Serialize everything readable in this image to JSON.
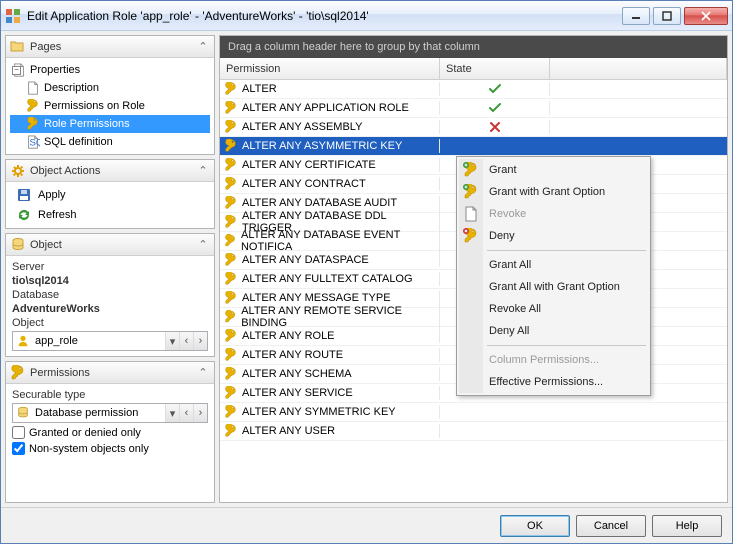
{
  "window": {
    "title": "Edit Application Role 'app_role' - 'AdventureWorks' - 'tio\\sql2014'"
  },
  "pages_panel": {
    "title": "Pages"
  },
  "pages": [
    {
      "label": "Properties",
      "selected": false
    },
    {
      "label": "Description",
      "selected": false
    },
    {
      "label": "Permissions on Role",
      "selected": false
    },
    {
      "label": "Role Permissions",
      "selected": true
    },
    {
      "label": "SQL definition",
      "selected": false
    }
  ],
  "actions_panel": {
    "title": "Object Actions"
  },
  "actions": [
    {
      "label": "Apply"
    },
    {
      "label": "Refresh"
    }
  ],
  "object_panel": {
    "title": "Object",
    "server_label": "Server",
    "server_value": "tio\\sql2014",
    "database_label": "Database",
    "database_value": "AdventureWorks",
    "object_label": "Object",
    "object_value": "app_role"
  },
  "permissions_panel": {
    "title": "Permissions",
    "securable_type_label": "Securable type",
    "securable_type_value": "Database permission",
    "granted_only_label": "Granted or denied only",
    "granted_only_checked": false,
    "non_system_label": "Non-system objects only",
    "non_system_checked": true
  },
  "grid": {
    "group_hint": "Drag a column header here to group by that column",
    "col_permission": "Permission",
    "col_state": "State",
    "rows": [
      {
        "perm": "ALTER",
        "state": "grant"
      },
      {
        "perm": "ALTER ANY APPLICATION ROLE",
        "state": "grant"
      },
      {
        "perm": "ALTER ANY ASSEMBLY",
        "state": "deny"
      },
      {
        "perm": "ALTER ANY ASYMMETRIC KEY",
        "state": "",
        "selected": true
      },
      {
        "perm": "ALTER ANY CERTIFICATE",
        "state": ""
      },
      {
        "perm": "ALTER ANY CONTRACT",
        "state": ""
      },
      {
        "perm": "ALTER ANY DATABASE AUDIT",
        "state": ""
      },
      {
        "perm": "ALTER ANY DATABASE DDL TRIGGER",
        "state": ""
      },
      {
        "perm": "ALTER ANY DATABASE EVENT NOTIFICA",
        "state": ""
      },
      {
        "perm": "ALTER ANY DATASPACE",
        "state": ""
      },
      {
        "perm": "ALTER ANY FULLTEXT CATALOG",
        "state": ""
      },
      {
        "perm": "ALTER ANY MESSAGE TYPE",
        "state": ""
      },
      {
        "perm": "ALTER ANY REMOTE SERVICE BINDING",
        "state": ""
      },
      {
        "perm": "ALTER ANY ROLE",
        "state": ""
      },
      {
        "perm": "ALTER ANY ROUTE",
        "state": ""
      },
      {
        "perm": "ALTER ANY SCHEMA",
        "state": ""
      },
      {
        "perm": "ALTER ANY SERVICE",
        "state": ""
      },
      {
        "perm": "ALTER ANY SYMMETRIC KEY",
        "state": ""
      },
      {
        "perm": "ALTER ANY USER",
        "state": ""
      }
    ]
  },
  "context_menu": {
    "items": [
      {
        "label": "Grant",
        "icon": "grant",
        "disabled": false
      },
      {
        "label": "Grant with Grant Option",
        "icon": "grant-opt",
        "disabled": false
      },
      {
        "label": "Revoke",
        "icon": "revoke",
        "disabled": true
      },
      {
        "label": "Deny",
        "icon": "deny",
        "disabled": false
      },
      {
        "sep": true
      },
      {
        "label": "Grant All",
        "disabled": false
      },
      {
        "label": "Grant All with Grant Option",
        "disabled": false
      },
      {
        "label": "Revoke All",
        "disabled": false
      },
      {
        "label": "Deny All",
        "disabled": false
      },
      {
        "sep": true
      },
      {
        "label": "Column Permissions...",
        "disabled": true
      },
      {
        "label": "Effective Permissions...",
        "disabled": false
      }
    ]
  },
  "footer": {
    "ok": "OK",
    "cancel": "Cancel",
    "help": "Help"
  }
}
